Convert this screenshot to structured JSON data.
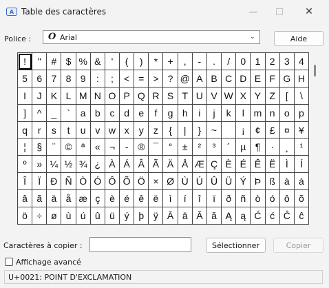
{
  "window": {
    "title": "Table des caractères"
  },
  "font": {
    "label": "Police :",
    "selected": "Arial",
    "glyph": "O"
  },
  "buttons": {
    "help": "Aide",
    "select": "Sélectionner",
    "copy": "Copier"
  },
  "copy": {
    "label": "Caractères à copier :",
    "value": ""
  },
  "advanced": {
    "label": "Affichage avancé",
    "checked": false
  },
  "status": {
    "text": "U+0021: POINT D'EXCLAMATION"
  },
  "grid": {
    "selected_index": 0,
    "rows": [
      [
        "!",
        "\"",
        "#",
        "$",
        "%",
        "&",
        "'",
        "(",
        ")",
        "*",
        "+",
        ",",
        "-",
        ".",
        "/",
        "0",
        "1",
        "2",
        "3",
        "4"
      ],
      [
        "5",
        "6",
        "7",
        "8",
        "9",
        ":",
        ";",
        "<",
        "=",
        ">",
        "?",
        "@",
        "A",
        "B",
        "C",
        "D",
        "E",
        "F",
        "G",
        "H"
      ],
      [
        "I",
        "J",
        "K",
        "L",
        "M",
        "N",
        "O",
        "P",
        "Q",
        "R",
        "S",
        "T",
        "U",
        "V",
        "W",
        "X",
        "Y",
        "Z",
        "[",
        "\\"
      ],
      [
        "]",
        "^",
        "_",
        "`",
        "a",
        "b",
        "c",
        "d",
        "e",
        "f",
        "g",
        "h",
        "i",
        "j",
        "k",
        "l",
        "m",
        "n",
        "o",
        "p"
      ],
      [
        "q",
        "r",
        "s",
        "t",
        "u",
        "v",
        "w",
        "x",
        "y",
        "z",
        "{",
        "|",
        "}",
        "~",
        " ",
        "¡",
        "¢",
        "£",
        "¤",
        "¥"
      ],
      [
        "¦",
        "§",
        "¨",
        "©",
        "ª",
        "«",
        "¬",
        "-",
        "®",
        "¯",
        "°",
        "±",
        "²",
        "³",
        "´",
        "µ",
        "¶",
        "·",
        "¸",
        "¹"
      ],
      [
        "º",
        "»",
        "¼",
        "½",
        "¾",
        "¿",
        "À",
        "Á",
        "Â",
        "Ã",
        "Ä",
        "Å",
        "Æ",
        "Ç",
        "È",
        "É",
        "Ê",
        "Ë",
        "Ì",
        "Í"
      ],
      [
        "Î",
        "Ï",
        "Ð",
        "Ñ",
        "Ò",
        "Ó",
        "Ô",
        "Õ",
        "Ö",
        "×",
        "Ø",
        "Ù",
        "Ú",
        "Û",
        "Ü",
        "Ý",
        "Þ",
        "ß",
        "à",
        "á"
      ],
      [
        "â",
        "ã",
        "ä",
        "å",
        "æ",
        "ç",
        "è",
        "é",
        "ê",
        "ë",
        "ì",
        "í",
        "î",
        "ï",
        "ð",
        "ñ",
        "ò",
        "ó",
        "ô",
        "õ"
      ],
      [
        "ö",
        "÷",
        "ø",
        "ù",
        "ú",
        "û",
        "ü",
        "ý",
        "þ",
        "ÿ",
        "Ā",
        "ā",
        "Ă",
        "ă",
        "Ą",
        "ą",
        "Ć",
        "ć",
        "Ĉ",
        "ĉ"
      ]
    ]
  },
  "icons": {
    "app": "character-map-icon",
    "minimize": "minimize-icon",
    "maximize": "maximize-icon",
    "close": "close-icon",
    "dropdown": "chevron-down-icon",
    "font_type": "opentype-font-icon"
  },
  "colors": {
    "window_bg": "#f3f3f3",
    "grid_border": "#444444",
    "disabled_text": "#9a9a9a"
  }
}
